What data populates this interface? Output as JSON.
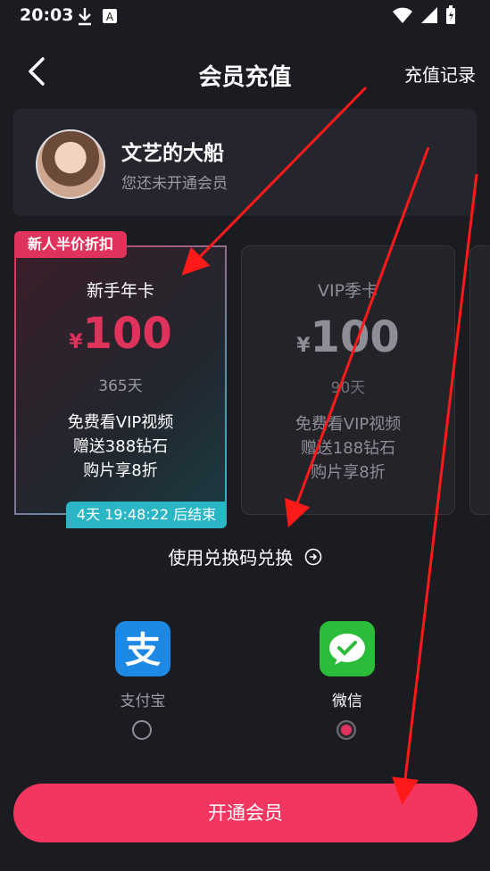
{
  "status_bar": {
    "time": "20:03"
  },
  "header": {
    "title": "会员充值",
    "records_link": "充值记录"
  },
  "profile": {
    "name": "文艺的大船",
    "status": "您还未开通会员"
  },
  "plans": [
    {
      "badge": "新人半价折扣",
      "name": "新手年卡",
      "currency": "¥",
      "price": "100",
      "days": "365天",
      "benefits": [
        "免费看VIP视频",
        "赠送388钻石",
        "购片享8折"
      ],
      "countdown": "4天 19:48:22 后结束",
      "selected": true
    },
    {
      "name": "VIP季卡",
      "currency": "¥",
      "price": "100",
      "days": "90天",
      "benefits": [
        "免费看VIP视频",
        "赠送188钻石",
        "购片享8折"
      ],
      "selected": false
    }
  ],
  "redeem": {
    "label": "使用兑换码兑换"
  },
  "payment": {
    "options": [
      {
        "label": "支付宝",
        "icon": "alipay-icon",
        "selected": false
      },
      {
        "label": "微信",
        "icon": "wechat-icon",
        "selected": true
      }
    ]
  },
  "submit": {
    "label": "开通会员"
  },
  "colors": {
    "accent": "#f2365f",
    "teal": "#2bb6c5",
    "background": "#1b1b22",
    "annotation": "#ff1a1a"
  }
}
